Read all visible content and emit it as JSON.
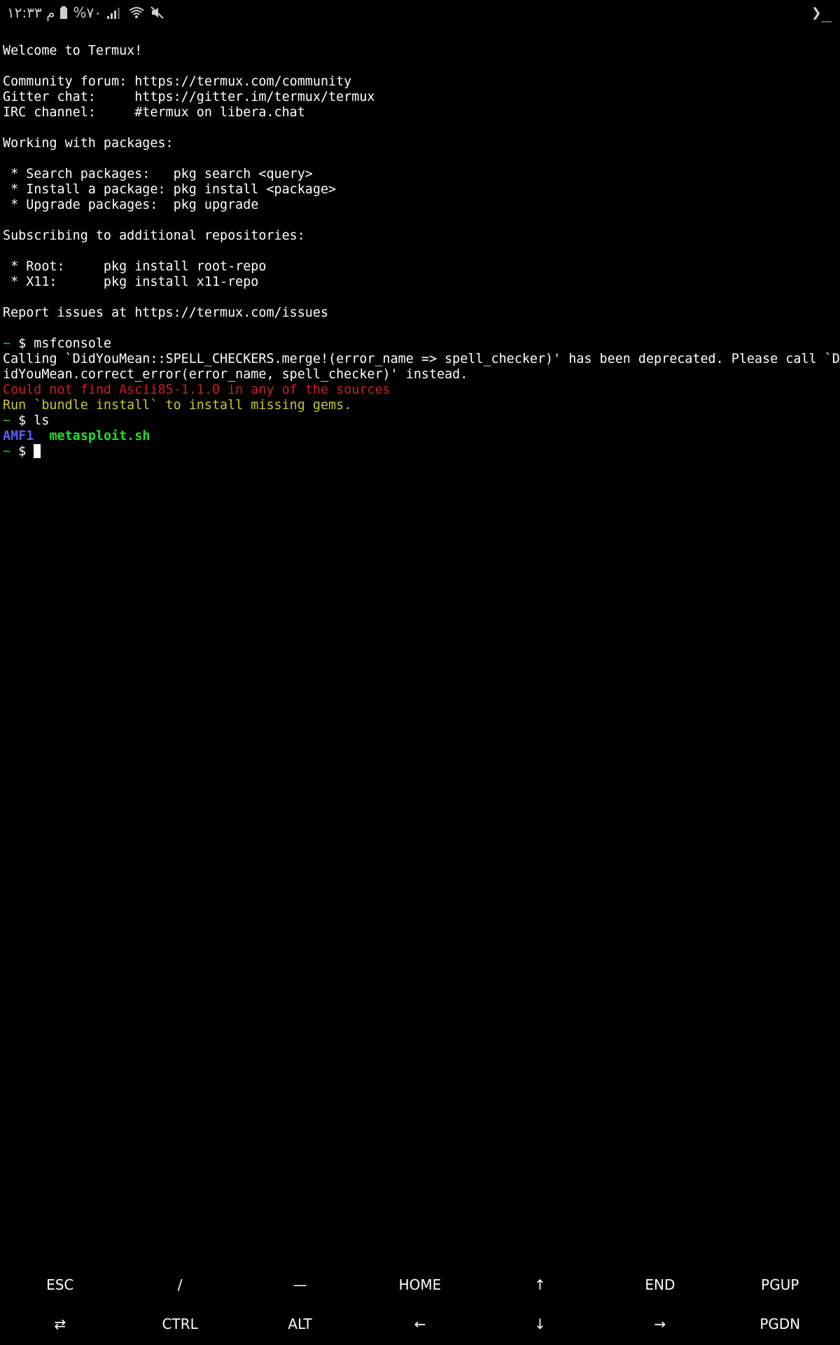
{
  "status_bar": {
    "time": "م ۱۲:۳۳",
    "battery": "%۷۰",
    "app_indicator": "❯_"
  },
  "terminal": {
    "lines": [
      {
        "segments": [
          {
            "text": "Welcome to Termux!",
            "color": "default"
          }
        ]
      },
      {
        "segments": [
          {
            "text": "",
            "color": "default"
          }
        ]
      },
      {
        "segments": [
          {
            "text": "Community forum: https://termux.com/community",
            "color": "default"
          }
        ]
      },
      {
        "segments": [
          {
            "text": "Gitter chat:     https://gitter.im/termux/termux",
            "color": "default"
          }
        ]
      },
      {
        "segments": [
          {
            "text": "IRC channel:     #termux on libera.chat",
            "color": "default"
          }
        ]
      },
      {
        "segments": [
          {
            "text": "",
            "color": "default"
          }
        ]
      },
      {
        "segments": [
          {
            "text": "Working with packages:",
            "color": "default"
          }
        ]
      },
      {
        "segments": [
          {
            "text": "",
            "color": "default"
          }
        ]
      },
      {
        "segments": [
          {
            "text": " * Search packages:   pkg search <query>",
            "color": "default"
          }
        ]
      },
      {
        "segments": [
          {
            "text": " * Install a package: pkg install <package>",
            "color": "default"
          }
        ]
      },
      {
        "segments": [
          {
            "text": " * Upgrade packages:  pkg upgrade",
            "color": "default"
          }
        ]
      },
      {
        "segments": [
          {
            "text": "",
            "color": "default"
          }
        ]
      },
      {
        "segments": [
          {
            "text": "Subscribing to additional repositories:",
            "color": "default"
          }
        ]
      },
      {
        "segments": [
          {
            "text": "",
            "color": "default"
          }
        ]
      },
      {
        "segments": [
          {
            "text": " * Root:     pkg install root-repo",
            "color": "default"
          }
        ]
      },
      {
        "segments": [
          {
            "text": " * X11:      pkg install x11-repo",
            "color": "default"
          }
        ]
      },
      {
        "segments": [
          {
            "text": "",
            "color": "default"
          }
        ]
      },
      {
        "segments": [
          {
            "text": "Report issues at https://termux.com/issues",
            "color": "default"
          }
        ]
      },
      {
        "segments": [
          {
            "text": "",
            "color": "default"
          }
        ]
      },
      {
        "segments": [
          {
            "text": "~",
            "color": "green"
          },
          {
            "text": " $ msfconsole",
            "color": "default"
          }
        ]
      },
      {
        "segments": [
          {
            "text": "Calling `DidYouMean::SPELL_CHECKERS.merge!(error_name => spell_checker)' has been deprecated. Please call `D",
            "color": "default"
          }
        ]
      },
      {
        "segments": [
          {
            "text": "idYouMean.correct_error(error_name, spell_checker)' instead.",
            "color": "default"
          }
        ]
      },
      {
        "segments": [
          {
            "text": "Could not find Ascii85-1.1.0 in any of the sources",
            "color": "red"
          }
        ]
      },
      {
        "segments": [
          {
            "text": "Run `bundle install` to install missing gems.",
            "color": "yellow"
          }
        ]
      },
      {
        "segments": [
          {
            "text": "~",
            "color": "green"
          },
          {
            "text": " $ ls",
            "color": "default"
          }
        ]
      },
      {
        "segments": [
          {
            "text": "AMF1",
            "color": "blue"
          },
          {
            "text": "  ",
            "color": "default"
          },
          {
            "text": "metasploit.sh",
            "color": "bgreen"
          }
        ]
      }
    ],
    "prompt": {
      "tilde": "~",
      "dollar": " $ "
    }
  },
  "extra_keys": [
    {
      "label": "ESC",
      "name": "esc-key"
    },
    {
      "label": "/",
      "name": "slash-key"
    },
    {
      "label": "—",
      "name": "dash-key"
    },
    {
      "label": "HOME",
      "name": "home-key"
    },
    {
      "label": "↑",
      "name": "arrow-up-key"
    },
    {
      "label": "END",
      "name": "end-key"
    },
    {
      "label": "PGUP",
      "name": "page-up-key"
    },
    {
      "label": "⇄",
      "name": "tab-key"
    },
    {
      "label": "CTRL",
      "name": "ctrl-key"
    },
    {
      "label": "ALT",
      "name": "alt-key"
    },
    {
      "label": "←",
      "name": "arrow-left-key"
    },
    {
      "label": "↓",
      "name": "arrow-down-key"
    },
    {
      "label": "→",
      "name": "arrow-right-key"
    },
    {
      "label": "PGDN",
      "name": "page-down-key"
    }
  ],
  "colors": {
    "background": "#000000",
    "text": "#ffffff",
    "green": "#2ec12e",
    "red": "#cc1f1f",
    "yellow": "#c8c832",
    "blue": "#5c5cff",
    "bright_green": "#21e021"
  }
}
